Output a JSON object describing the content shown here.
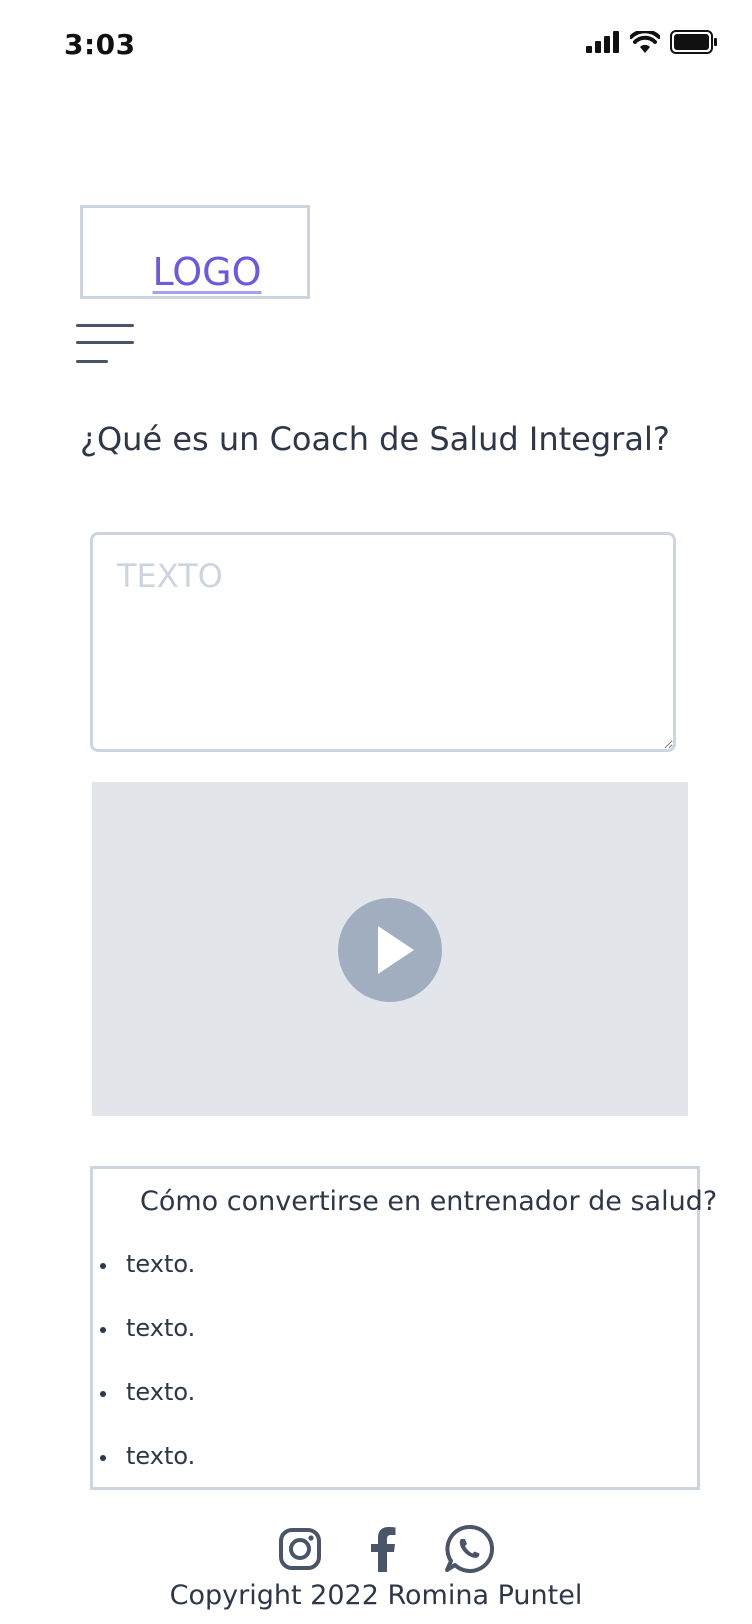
{
  "status_bar": {
    "time": "3:03",
    "icons": [
      "signal-icon",
      "wifi-icon",
      "battery-icon"
    ]
  },
  "header": {
    "logo_text": "LOGO",
    "menu_icon": "hamburger-menu-icon"
  },
  "main": {
    "title": "¿Qué es un Coach de Salud Integral?",
    "text_placeholder": "TEXTO",
    "video": {
      "control_icon": "play-icon"
    },
    "info": {
      "title": "Cómo convertirse en entrenador de salud?",
      "items": [
        "texto.",
        "texto.",
        "texto.",
        "texto."
      ]
    }
  },
  "footer": {
    "social": [
      "instagram-icon",
      "facebook-icon",
      "whatsapp-icon"
    ],
    "copyright": "Copyright 2022 Romina Puntel"
  },
  "colors": {
    "accent": "#6a5ae0",
    "border": "#cbd5e0",
    "text": "#2d3748",
    "video_bg": "#e2e6ea",
    "play_button": "#a0aec0"
  }
}
